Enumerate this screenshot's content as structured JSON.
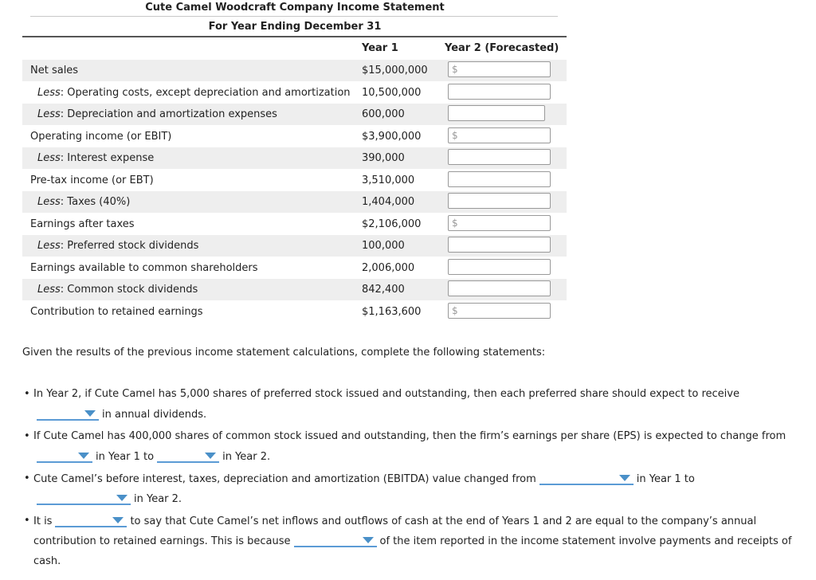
{
  "statement": {
    "title": "Cute Camel Woodcraft Company Income Statement",
    "subtitle": "For Year Ending December 31",
    "col_year1": "Year 1",
    "col_year2": "Year 2 (Forecasted)",
    "rows": [
      {
        "prefix": "",
        "label": "Net sales",
        "year1": "$15,000,000",
        "year2_value": "",
        "year2_prefix": "$"
      },
      {
        "prefix": "Less",
        "label": ": Operating costs, except depreciation and amortization",
        "year1": "10,500,000",
        "year2_value": "",
        "year2_prefix": ""
      },
      {
        "prefix": "Less",
        "label": ": Depreciation and amortization expenses",
        "year1": "600,000",
        "year2_value": "",
        "year2_prefix": ""
      },
      {
        "prefix": "",
        "label": "Operating income (or EBIT)",
        "year1": "$3,900,000",
        "year2_value": "",
        "year2_prefix": "$"
      },
      {
        "prefix": "Less",
        "label": ": Interest expense",
        "year1": "390,000",
        "year2_value": "",
        "year2_prefix": ""
      },
      {
        "prefix": "",
        "label": "Pre-tax income (or EBT)",
        "year1": "3,510,000",
        "year2_value": "",
        "year2_prefix": ""
      },
      {
        "prefix": "Less",
        "label": ": Taxes (40%)",
        "year1": "1,404,000",
        "year2_value": "",
        "year2_prefix": ""
      },
      {
        "prefix": "",
        "label": "Earnings after taxes",
        "year1": "$2,106,000",
        "year2_value": "",
        "year2_prefix": "$"
      },
      {
        "prefix": "Less",
        "label": ": Preferred stock dividends",
        "year1": "100,000",
        "year2_value": "",
        "year2_prefix": ""
      },
      {
        "prefix": "",
        "label": "Earnings available to common shareholders",
        "year1": "2,006,000",
        "year2_value": "",
        "year2_prefix": ""
      },
      {
        "prefix": "Less",
        "label": ": Common stock dividends",
        "year1": "842,400",
        "year2_value": "",
        "year2_prefix": ""
      },
      {
        "prefix": "",
        "label": "Contribution to retained earnings",
        "year1": "$1,163,600",
        "year2_value": "",
        "year2_prefix": "$"
      }
    ]
  },
  "questions": {
    "intro": "Given the results of the previous income statement calculations, complete the following statements:",
    "q1": {
      "line1": "In Year 2, if Cute Camel has 5,000 shares of preferred stock issued and outstanding, then each preferred share should expect to receive",
      "after_dd1": "in annual dividends.",
      "dd1_value": ""
    },
    "q2": {
      "line1": "If Cute Camel has 400,000 shares of common stock issued and outstanding, then the firm’s earnings per share (EPS) is expected to change from",
      "after_dd1": "in Year 1 to",
      "after_dd2": "in Year 2.",
      "dd1_value": "",
      "dd2_value": ""
    },
    "q3": {
      "line1": "Cute Camel’s before interest, taxes, depreciation and amortization (EBITDA) value changed from",
      "after_dd1": "in Year 1 to",
      "after_dd2": "in Year 2.",
      "dd1_value": "",
      "dd2_value": ""
    },
    "q4": {
      "before_dd1": "It is",
      "after_dd1": "to say that Cute Camel’s net inflows and outflows of cash at the end of Years 1 and 2 are equal to the company’s annual",
      "line2_before_dd2": "contribution to retained earnings. This is because",
      "after_dd2": "of the item reported in the income statement involve payments and receipts of",
      "line3": "cash.",
      "dd1_value": "",
      "dd2_value": ""
    }
  }
}
